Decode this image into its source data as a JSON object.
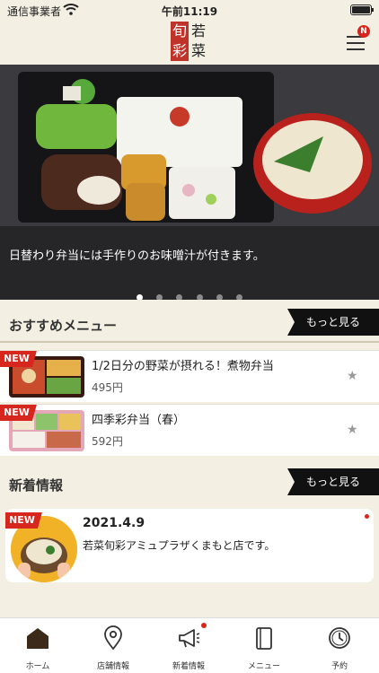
{
  "status": {
    "carrier": "通信事業者",
    "time": "午前11:19"
  },
  "header": {
    "logo_red": "旬彩",
    "logo_dark": "若菜",
    "menu_badge": "N"
  },
  "hero": {
    "caption": "日替わり弁当には手作りのお味噌汁が付きます。",
    "slides": 6,
    "active_slide": 1
  },
  "recommend": {
    "title": "おすすめメニュー",
    "more_label": "もっと見る",
    "items": [
      {
        "tag": "NEW",
        "name": "1/2日分の野菜が摂れる！煮物弁当",
        "price": "495円"
      },
      {
        "tag": "NEW",
        "name": "四季彩弁当（春）",
        "price": "592円"
      }
    ]
  },
  "news": {
    "title": "新着情報",
    "more_label": "もっと見る",
    "items": [
      {
        "tag": "NEW",
        "date": "2021.4.9",
        "text": "若菜旬彩アミュプラザくまもと店です。"
      }
    ]
  },
  "tabbar": {
    "items": [
      {
        "label": "ホーム",
        "icon": "home-icon"
      },
      {
        "label": "店舗情報",
        "icon": "map-pin-icon"
      },
      {
        "label": "新着情報",
        "icon": "megaphone-icon"
      },
      {
        "label": "メニュー",
        "icon": "book-icon"
      },
      {
        "label": "予約",
        "icon": "clock-icon"
      }
    ]
  },
  "colors": {
    "accent": "#d7261e",
    "background": "#f3efe2",
    "dark": "#111111"
  }
}
